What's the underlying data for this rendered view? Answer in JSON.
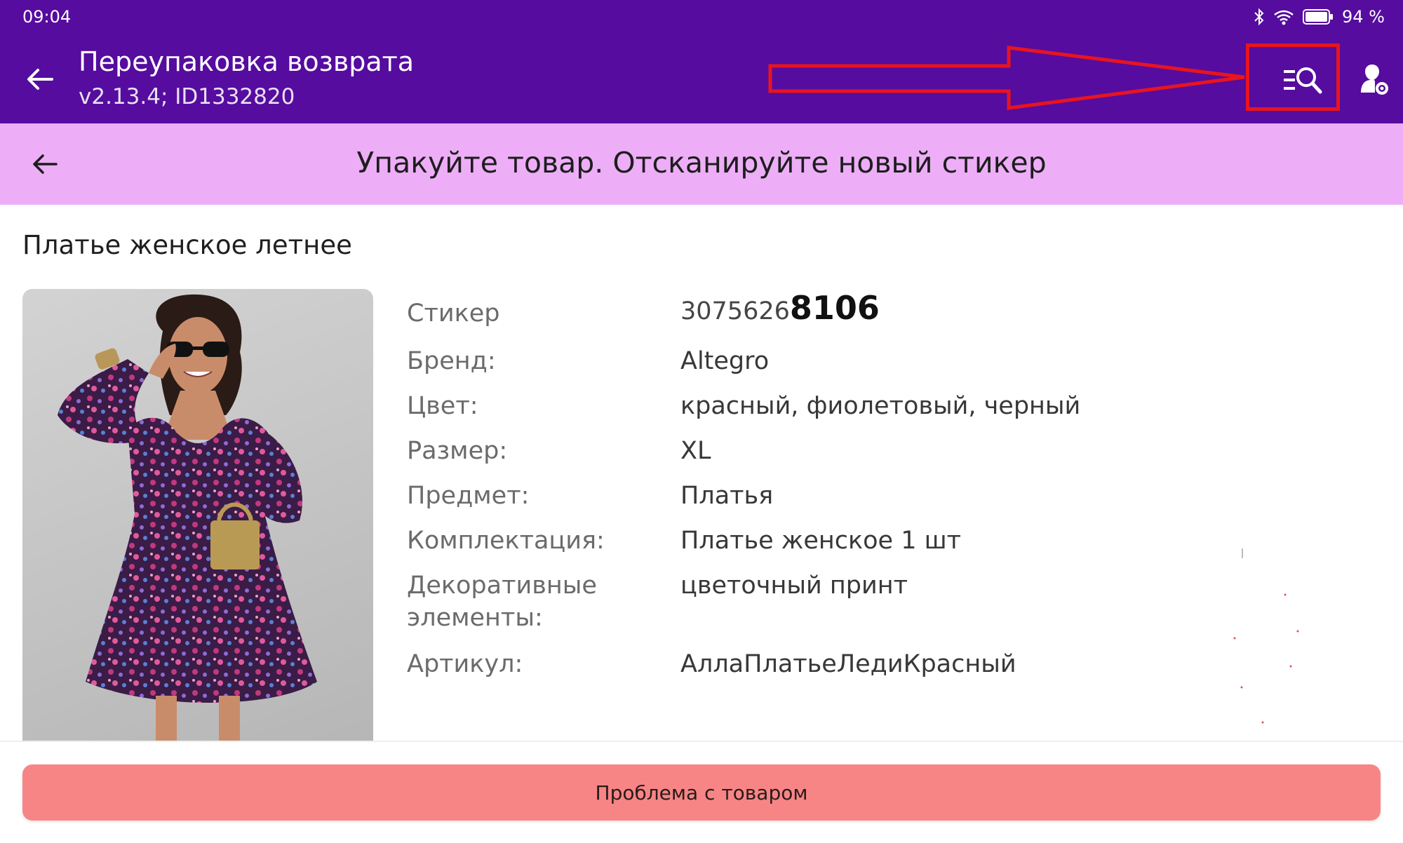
{
  "status_bar": {
    "time": "09:04",
    "battery": "94 %",
    "icons": [
      "bluetooth-icon",
      "wifi-icon",
      "battery-icon"
    ]
  },
  "app_bar": {
    "title": "Переупаковка возврата",
    "subtitle": "v2.13.4; ID1332820",
    "icons": [
      "back-arrow-icon",
      "search-list-icon",
      "user-settings-icon"
    ],
    "background": "#560c9e"
  },
  "step": {
    "text": "Упакуйте товар. Отсканируйте новый стикер",
    "background": "#edaef7"
  },
  "product": {
    "title": "Платье женское летнее",
    "image_icon": "product-photo-dress",
    "attributes": [
      {
        "label": "Стикер",
        "value_prefix": "3075626",
        "value_suffix": "8106"
      },
      {
        "label": "Бренд:",
        "value": "Altegro"
      },
      {
        "label": "Цвет:",
        "value": "красный, фиолетовый, черный"
      },
      {
        "label": "Размер:",
        "value": "XL"
      },
      {
        "label": "Предмет:",
        "value": "Платья"
      },
      {
        "label": "Комплектация:",
        "value": "Платье женское 1 шт"
      },
      {
        "label": "Декоративные элементы:",
        "value": "цветочный принт"
      },
      {
        "label": "Артикул:",
        "value": "АллаПлатьеЛедиКрасный"
      }
    ]
  },
  "footer": {
    "problem_button": "Проблема с товаром",
    "button_color": "#f88585"
  },
  "annotation": {
    "color": "#e8141f",
    "shape": "arrow pointing to search-list button"
  }
}
